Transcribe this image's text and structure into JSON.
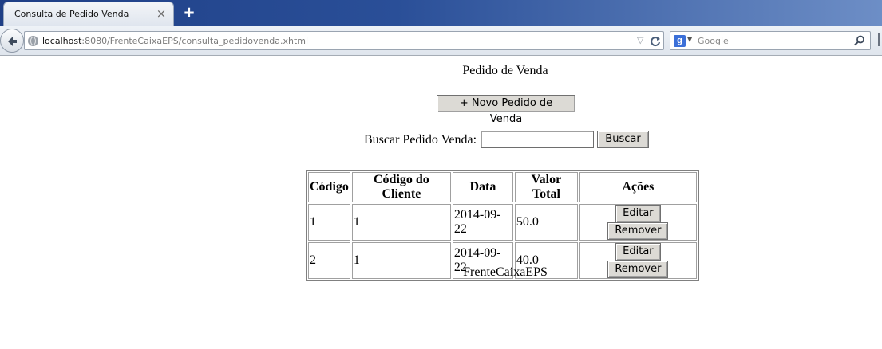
{
  "browser": {
    "tab_title": "Consulta de Pedido Venda",
    "tab_close": "×",
    "new_tab": "+",
    "url_host": "localhost",
    "url_rest": ":8080/FrenteCaixaEPS/consulta_pedidovenda.xhtml",
    "search_engine_letter": "g",
    "search_placeholder": "Google",
    "reload": "C",
    "dropdown": "▽"
  },
  "page": {
    "title": "Pedido de Venda",
    "new_button": "+ Novo Pedido de Venda",
    "search_label": "Buscar Pedido Venda:",
    "search_value": "",
    "search_button": "Buscar",
    "footer": "FrenteCaixaEPS"
  },
  "table": {
    "headers": [
      "Código",
      "Código do Cliente",
      "Data",
      "Valor Total",
      "Ações"
    ],
    "rows": [
      {
        "codigo": "1",
        "cliente": "1",
        "data": "2014-09-22",
        "valor": "50.0"
      },
      {
        "codigo": "2",
        "cliente": "1",
        "data": "2014-09-22",
        "valor": "40.0"
      }
    ],
    "edit_label": "Editar",
    "remove_label": "Remover"
  },
  "colors": {
    "tabstrip": "#2a4f98",
    "button_face": "#dcdad5"
  }
}
